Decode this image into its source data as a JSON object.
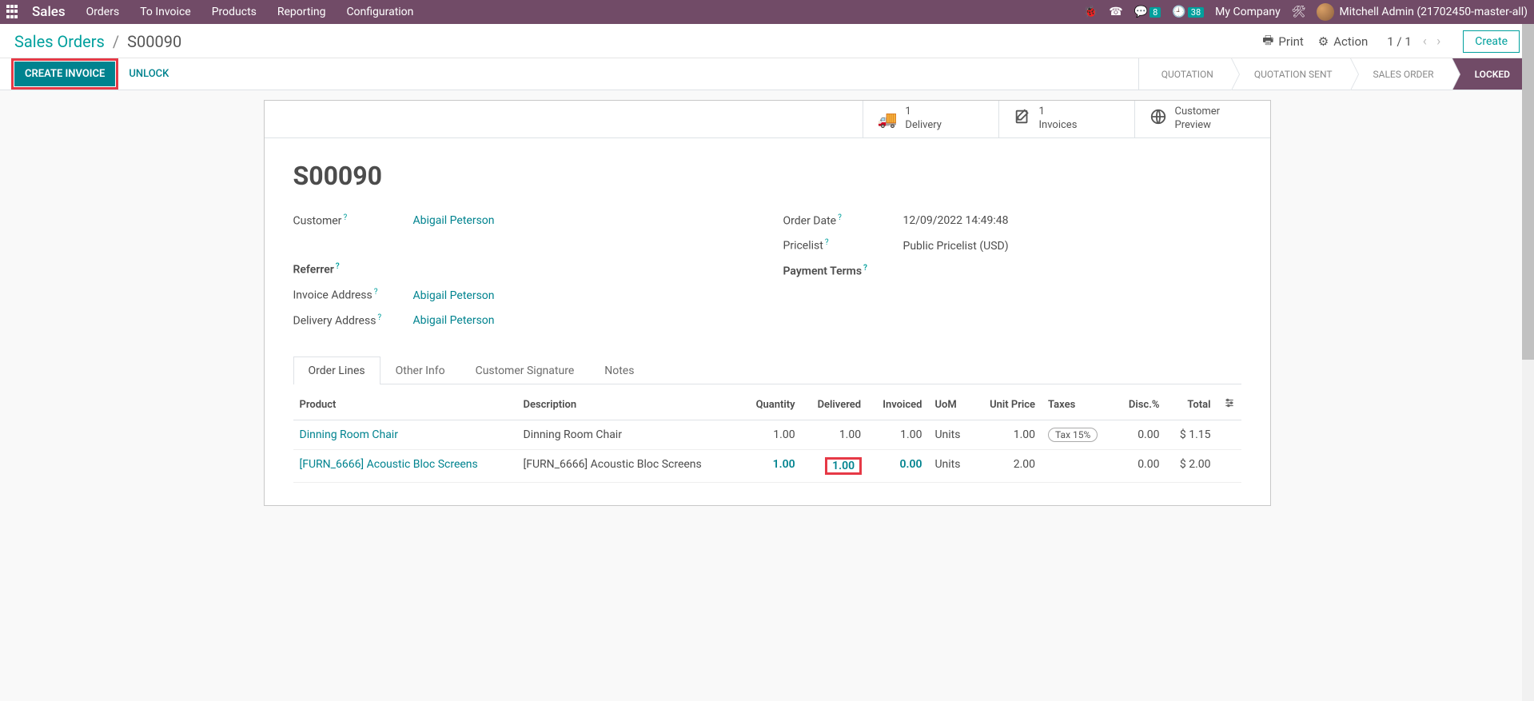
{
  "topbar": {
    "brand": "Sales",
    "nav": [
      "Orders",
      "To Invoice",
      "Products",
      "Reporting",
      "Configuration"
    ],
    "messaging_badge": "8",
    "activities_badge": "38",
    "company": "My Company",
    "user": "Mitchell Admin (21702450-master-all)"
  },
  "controlbar": {
    "breadcrumb_root": "Sales Orders",
    "breadcrumb_current": "S00090",
    "print": "Print",
    "action": "Action",
    "pager": "1 / 1",
    "create": "Create"
  },
  "statusbar": {
    "create_invoice": "CREATE INVOICE",
    "unlock": "UNLOCK",
    "steps": [
      "QUOTATION",
      "QUOTATION SENT",
      "SALES ORDER",
      "LOCKED"
    ]
  },
  "stat_buttons": {
    "delivery": {
      "count": "1",
      "label": "Delivery"
    },
    "invoices": {
      "count": "1",
      "label": "Invoices"
    },
    "preview": {
      "l1": "Customer",
      "l2": "Preview"
    }
  },
  "record": {
    "title": "S00090",
    "labels": {
      "customer": "Customer",
      "referrer": "Referrer",
      "invoice_address": "Invoice Address",
      "delivery_address": "Delivery Address",
      "order_date": "Order Date",
      "pricelist": "Pricelist",
      "payment_terms": "Payment Terms"
    },
    "values": {
      "customer": "Abigail Peterson",
      "invoice_address": "Abigail Peterson",
      "delivery_address": "Abigail Peterson",
      "order_date": "12/09/2022 14:49:48",
      "pricelist": "Public Pricelist (USD)"
    }
  },
  "tabs": [
    "Order Lines",
    "Other Info",
    "Customer Signature",
    "Notes"
  ],
  "lines": {
    "headers": {
      "product": "Product",
      "description": "Description",
      "quantity": "Quantity",
      "delivered": "Delivered",
      "invoiced": "Invoiced",
      "uom": "UoM",
      "unit_price": "Unit Price",
      "taxes": "Taxes",
      "disc": "Disc.%",
      "total": "Total"
    },
    "rows": [
      {
        "product": "Dinning Room Chair",
        "description": "Dinning Room Chair",
        "quantity": "1.00",
        "delivered": "1.00",
        "invoiced": "1.00",
        "uom": "Units",
        "unit_price": "1.00",
        "tax": "Tax 15%",
        "disc": "0.00",
        "total": "$ 1.15"
      },
      {
        "product": "[FURN_6666] Acoustic Bloc Screens",
        "description": "[FURN_6666] Acoustic Bloc Screens",
        "quantity": "1.00",
        "delivered": "1.00",
        "invoiced": "0.00",
        "uom": "Units",
        "unit_price": "2.00",
        "tax": "",
        "disc": "0.00",
        "total": "$ 2.00"
      }
    ]
  }
}
